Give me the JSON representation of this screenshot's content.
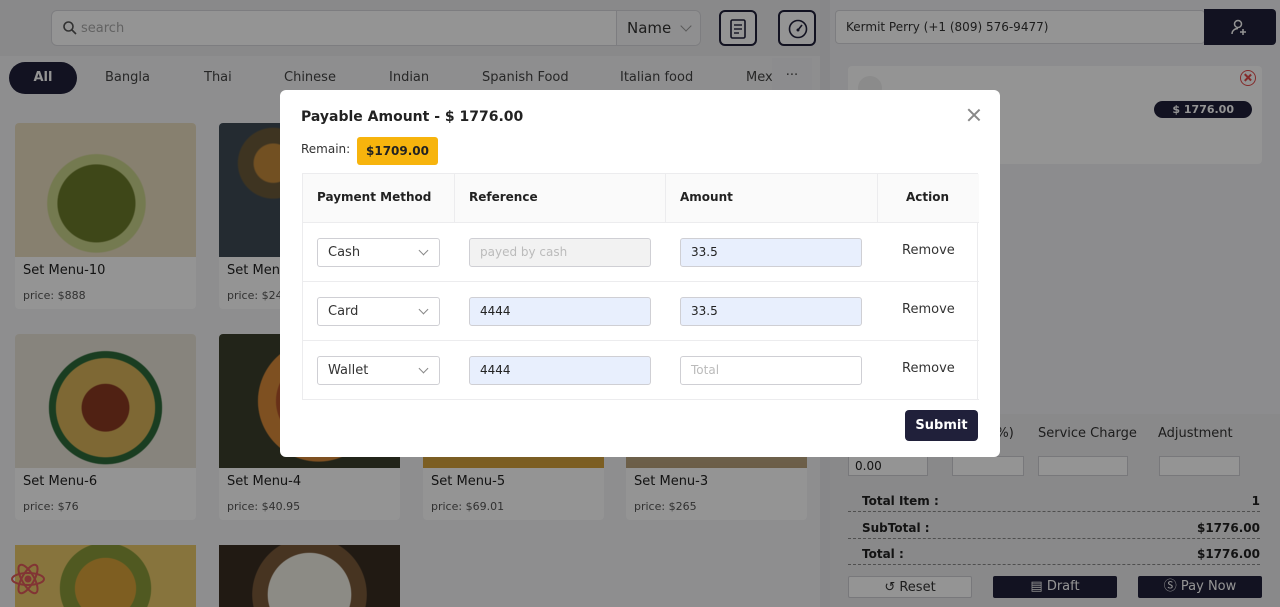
{
  "search": {
    "placeholder": "search",
    "filter_label": "Name"
  },
  "categories": [
    "All",
    "Bangla",
    "Thai",
    "Chinese",
    "Indian",
    "Spanish Food",
    "Italian food",
    "Mex",
    "···"
  ],
  "products": [
    {
      "name": "Set Menu-10",
      "price": "price: $888"
    },
    {
      "name": "Set Menu",
      "price": "price: $24"
    },
    {
      "name": "Set Menu-6",
      "price": "price: $76"
    },
    {
      "name": "Set Menu-4",
      "price": "price: $40.95"
    },
    {
      "name": "Set Menu-5",
      "price": "price: $69.01"
    },
    {
      "name": "Set Menu-3",
      "price": "price: $265"
    }
  ],
  "cart": {
    "customer": "Kermit Perry (+1 (809) 576-9477)",
    "item_total": "$ 1776.00",
    "labels": {
      "discount": "nt(%)",
      "service_charge": "Service Charge",
      "adjustment": "Adjustment"
    },
    "discount_value": "0.00",
    "total_item_label": "Total Item :",
    "total_item_value": "1",
    "subtotal_label": "SubTotal :",
    "subtotal_value": "$1776.00",
    "total_label": "Total :",
    "total_value": "$1776.00",
    "buttons": {
      "reset": "Reset",
      "draft": "Draft",
      "pay": "Pay Now"
    }
  },
  "modal": {
    "title": "Payable Amount - $ 1776.00",
    "remain_label": "Remain:",
    "remain_value": "$1709.00",
    "headers": {
      "method": "Payment Method",
      "reference": "Reference",
      "amount": "Amount",
      "action": "Action"
    },
    "rows": [
      {
        "method": "Cash",
        "reference": "",
        "reference_placeholder": "payed by cash",
        "amount": "33.5",
        "amount_placeholder": "",
        "action": "Remove"
      },
      {
        "method": "Card",
        "reference": "4444",
        "reference_placeholder": "",
        "amount": "33.5",
        "amount_placeholder": "",
        "action": "Remove"
      },
      {
        "method": "Wallet",
        "reference": "4444",
        "reference_placeholder": "",
        "amount": "",
        "amount_placeholder": "Total",
        "action": "Remove"
      }
    ],
    "submit_label": "Submit"
  },
  "colors": {
    "primary": "#20203a",
    "accent": "#f7b40d",
    "input_filled": "#e8effd",
    "danger": "#e34b4b"
  }
}
